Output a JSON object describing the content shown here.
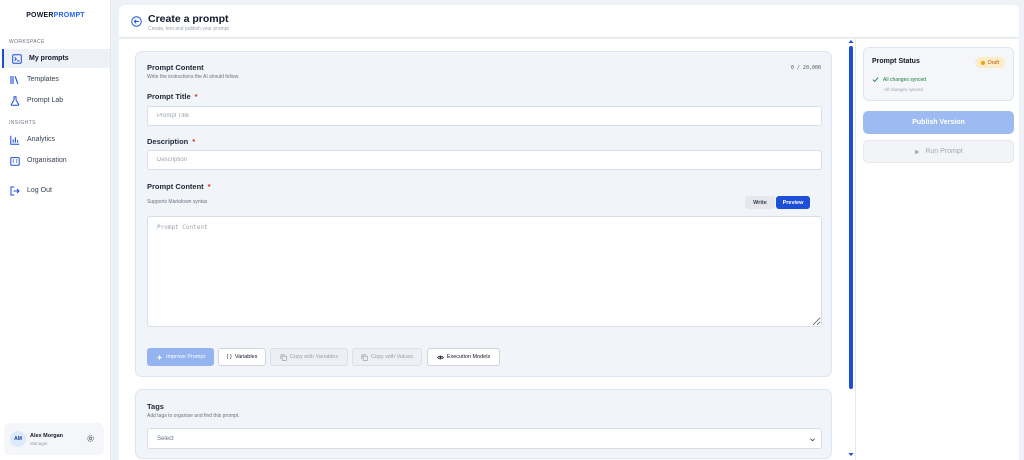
{
  "brand": {
    "part1": "POWER",
    "part2": "PROMPT"
  },
  "sidebar": {
    "sections": [
      {
        "label": "WORKSPACE",
        "items": [
          {
            "label": "My prompts",
            "icon": "prompt-terminal-icon",
            "active": true
          },
          {
            "label": "Templates",
            "icon": "library-icon"
          },
          {
            "label": "Prompt Lab",
            "icon": "flask-icon"
          }
        ]
      },
      {
        "label": "INSIGHTS",
        "items": [
          {
            "label": "Analytics",
            "icon": "bar-chart-icon"
          },
          {
            "label": "Organisation",
            "icon": "building-icon"
          }
        ]
      }
    ],
    "logout": "Log Out",
    "user": {
      "initials": "AM",
      "name": "Alex Morgan",
      "role": "Manager"
    }
  },
  "header": {
    "title": "Create a prompt",
    "subtitle": "Create, test and publish your prompt"
  },
  "prompt_card": {
    "title": "Prompt Content",
    "subtitle": "Write the instructions the AI should follow.",
    "char_count": "0 / 20,000",
    "fields": {
      "title_label": "Prompt Title",
      "title_placeholder": "Prompt Title",
      "desc_label": "Description",
      "desc_placeholder": "Description",
      "content_label": "Prompt Content",
      "content_note": "Supports Markdown syntax",
      "content_placeholder": "Prompt Content",
      "required_mark": "*"
    },
    "toggle": {
      "write": "Write",
      "preview": "Preview",
      "active": "preview"
    },
    "actions": {
      "improve": "Improve Prompt",
      "variables": "Variables",
      "variables_glyph": "{ }",
      "copy_vars": "Copy with Variables",
      "copy_vals": "Copy with Values",
      "exec_models": "Execution Models"
    }
  },
  "tags_card": {
    "title": "Tags",
    "subtitle": "Add tags to organise and find this prompt.",
    "select_value": "Select"
  },
  "status_panel": {
    "title": "Prompt Status",
    "badge": "Draft",
    "sync_status": "All changes synced",
    "sync_sub": "All changes synced",
    "publish": "Publish Version",
    "run": "Run Prompt"
  },
  "colors": {
    "accent": "#1d4ed8",
    "draft_bg": "#fdecc8",
    "draft_text": "#b45309",
    "synced": "#15803d",
    "required": "#dc2626"
  }
}
